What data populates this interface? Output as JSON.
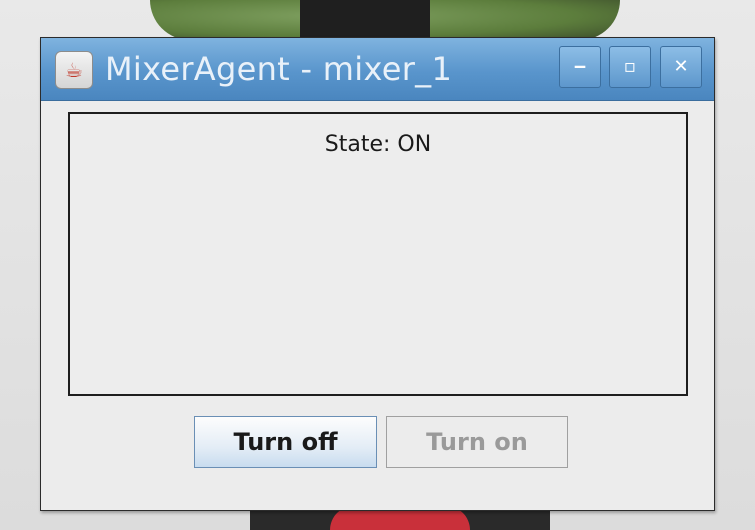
{
  "window": {
    "title": "MixerAgent - mixer_1",
    "app_icon": "java-icon",
    "controls": {
      "minimize_label": "‒",
      "maximize_label": "▫",
      "close_label": "✕"
    }
  },
  "status": {
    "text": "State: ON"
  },
  "buttons": {
    "turn_off": "Turn off",
    "turn_on": "Turn on"
  },
  "colors": {
    "titlebar": "#5995cc",
    "window_bg": "#ececec",
    "disabled_text": "#9a9a9a"
  }
}
